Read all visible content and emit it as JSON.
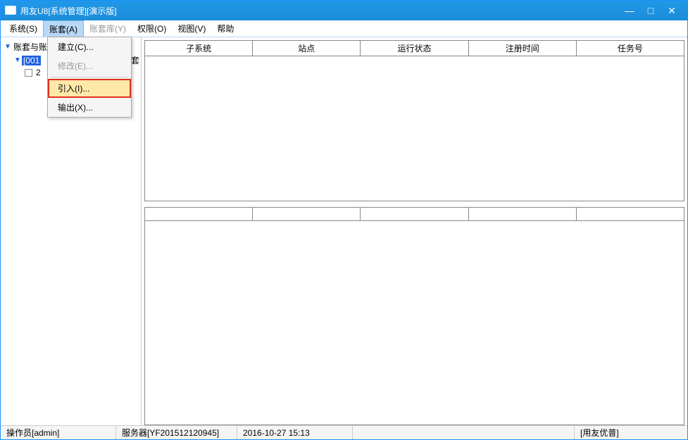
{
  "title": "用友U8[系统管理][演示版]",
  "window_controls": {
    "min": "—",
    "max": "□",
    "close": "✕"
  },
  "menu": {
    "system": "系统(S)",
    "account": "账套(A)",
    "account_lib": "账套库(Y)",
    "permission": "权限(O)",
    "view": "视图(V)",
    "help": "帮助"
  },
  "dropdown": {
    "create": "建立(C)...",
    "modify": "修改(E)...",
    "import": "引入(I)...",
    "export": "输出(X)..."
  },
  "tree": {
    "root": "账套与账套库",
    "node1": "[001",
    "node1_suffix": "套",
    "node2": "2"
  },
  "columns": {
    "subsystem": "子系统",
    "site": "站点",
    "run_status": "运行状态",
    "reg_time": "注册时间",
    "task_no": "任务号"
  },
  "bottom_cols": [
    "",
    "",
    "",
    "",
    ""
  ],
  "status": {
    "operator": "操作员[admin]",
    "server": "服务器[YF201512120945]",
    "datetime": "2016-10-27 15:13",
    "company": "[用友优普]"
  }
}
